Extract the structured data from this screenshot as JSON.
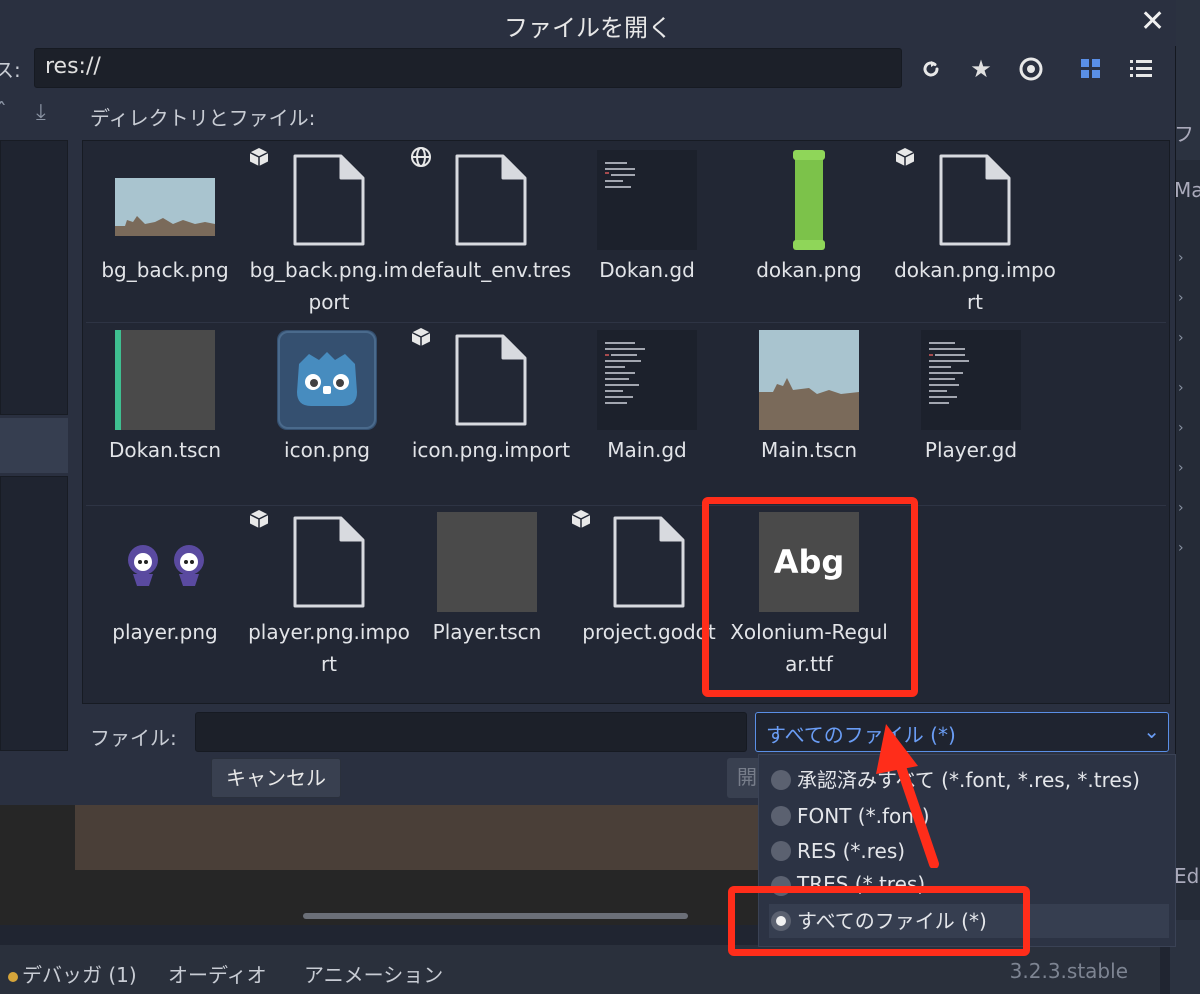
{
  "dialog": {
    "title": "ファイルを開く",
    "path_label_fragment": "ス:",
    "path_value": "res://",
    "dir_label": "ディレクトリとファイル:",
    "file_label": "ファイル:",
    "filter_selected": "すべてのファイル (*)",
    "cancel_label": "キャンセル",
    "open_label_fragment": "開"
  },
  "files": [
    {
      "name": "bg_back.png",
      "kind": "landscape-thumb"
    },
    {
      "name": "bg_back.png.import",
      "kind": "file",
      "badge": "cube-icon"
    },
    {
      "name": "default_env.tres",
      "kind": "file",
      "badge": "globe-icon"
    },
    {
      "name": "Dokan.gd",
      "kind": "script-thumb"
    },
    {
      "name": "dokan.png",
      "kind": "pipe-thumb"
    },
    {
      "name": "dokan.png.import",
      "kind": "file",
      "badge": "cube-icon"
    },
    {
      "name": "Dokan.tscn",
      "kind": "scene-thumb-green"
    },
    {
      "name": "icon.png",
      "kind": "godot-thumb"
    },
    {
      "name": "icon.png.import",
      "kind": "file",
      "badge": "cube-icon"
    },
    {
      "name": "Main.gd",
      "kind": "script-thumb"
    },
    {
      "name": "Main.tscn",
      "kind": "landscape-thumb2"
    },
    {
      "name": "Player.gd",
      "kind": "script-thumb"
    },
    {
      "name": "player.png",
      "kind": "sprite-thumb"
    },
    {
      "name": "player.png.import",
      "kind": "file",
      "badge": "cube-icon"
    },
    {
      "name": "Player.tscn",
      "kind": "gray-thumb"
    },
    {
      "name": "project.godot",
      "kind": "file",
      "badge": "cube-icon"
    },
    {
      "name": "Xolonium-Regular.ttf",
      "kind": "font-thumb",
      "preview": "Abg"
    }
  ],
  "filter_options": [
    {
      "label": "承認済みすべて (*.font, *.res, *.tres)",
      "selected": false
    },
    {
      "label": "FONT (*.font)",
      "selected": false
    },
    {
      "label": "RES (*.res)",
      "selected": false
    },
    {
      "label": "TRES (*.tres)",
      "selected": false
    },
    {
      "label": "すべてのファイル (*)",
      "selected": true
    }
  ],
  "bottom_tabs": {
    "debugger": "デバッガ (1)",
    "audio": "オーディオ",
    "animation": "アニメーション",
    "version": "3.2.3.stable"
  },
  "right_edge": {
    "top": "フ",
    "mid": "Ma",
    "bottom": "Edi"
  },
  "colors": {
    "accent": "#5a8fe6",
    "highlight": "#ff2d1a",
    "dialog_bg": "#2a3040",
    "grid_bg": "#222734"
  }
}
